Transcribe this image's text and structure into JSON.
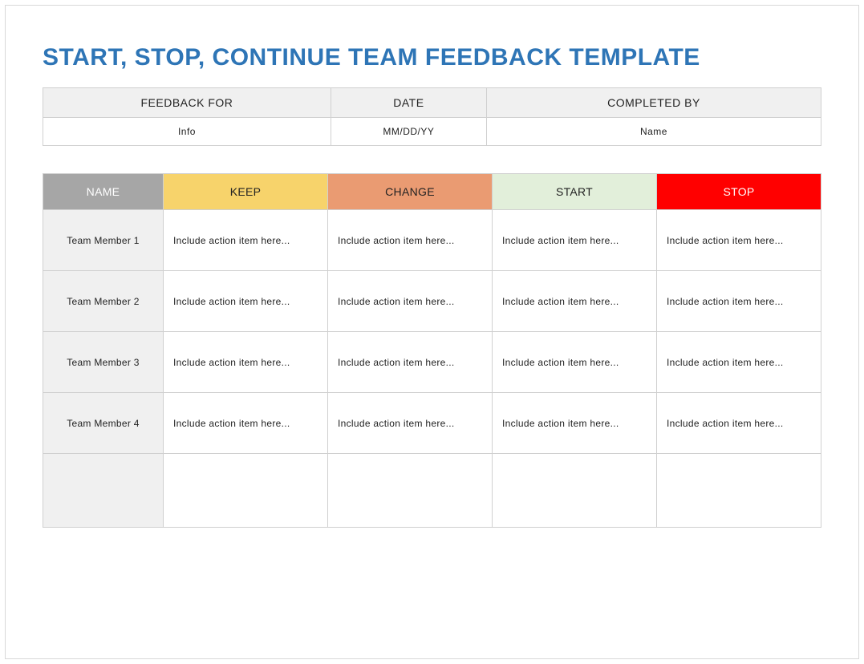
{
  "title": "START, STOP, CONTINUE TEAM FEEDBACK TEMPLATE",
  "meta": {
    "headers": {
      "feedback_for": "FEEDBACK FOR",
      "date": "DATE",
      "completed_by": "COMPLETED BY"
    },
    "values": {
      "feedback_for": "Info",
      "date": "MM/DD/YY",
      "completed_by": "Name"
    }
  },
  "grid": {
    "headers": {
      "name": "NAME",
      "keep": "KEEP",
      "change": "CHANGE",
      "start": "START",
      "stop": "STOP"
    },
    "rows": [
      {
        "name": "Team Member 1",
        "keep": "Include action item here...",
        "change": "Include action item here...",
        "start": "Include action item here...",
        "stop": "Include action item here..."
      },
      {
        "name": "Team Member 2",
        "keep": "Include action item here...",
        "change": "Include action item here...",
        "start": "Include action item here...",
        "stop": "Include action item here..."
      },
      {
        "name": "Team Member 3",
        "keep": "Include action item here...",
        "change": "Include action item here...",
        "start": "Include action item here...",
        "stop": "Include action item here..."
      },
      {
        "name": "Team Member 4",
        "keep": "Include action item here...",
        "change": "Include action item here...",
        "start": "Include action item here...",
        "stop": "Include action item here..."
      },
      {
        "name": "",
        "keep": "",
        "change": "",
        "start": "",
        "stop": ""
      }
    ]
  },
  "colors": {
    "title": "#2e75b6",
    "name_bg": "#a6a6a6",
    "keep_bg": "#f7d36b",
    "change_bg": "#ea9b72",
    "start_bg": "#e2efda",
    "stop_bg": "#ff0000"
  }
}
